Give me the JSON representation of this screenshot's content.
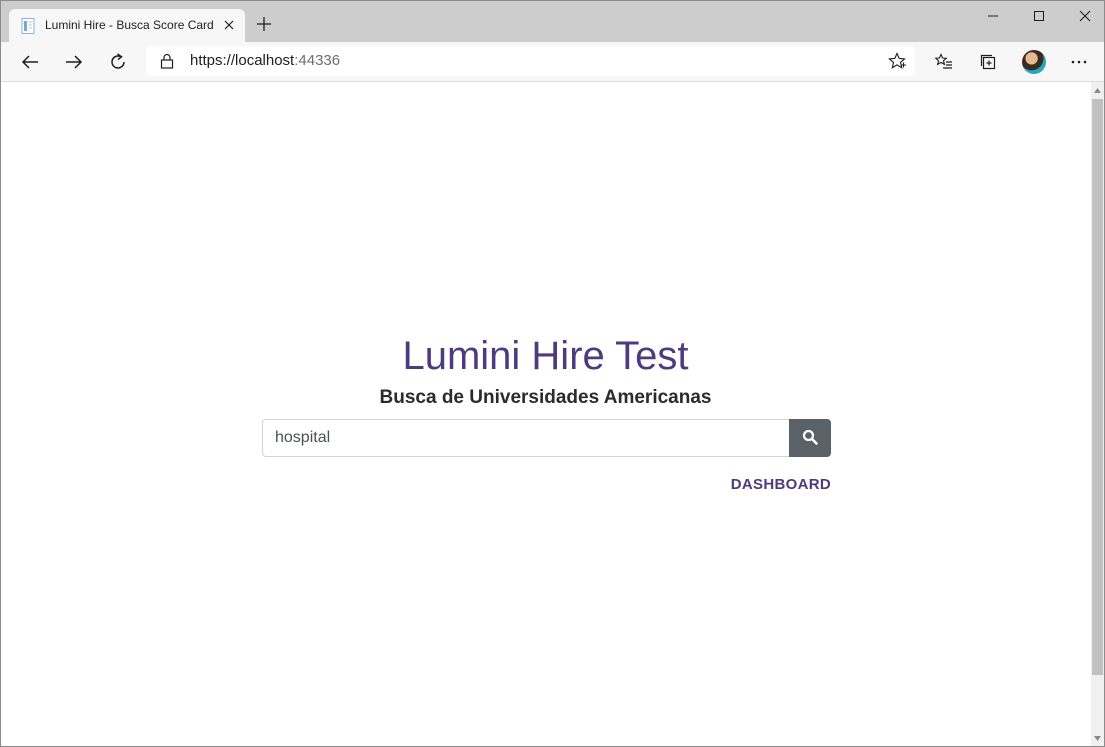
{
  "browser": {
    "tab_title": "Lumini Hire - Busca Score Card",
    "url_main": "https://localhost",
    "url_port": ":44336"
  },
  "page": {
    "title": "Lumini Hire Test",
    "subtitle": "Busca de Universidades Americanas",
    "search": {
      "value": "hospital"
    },
    "dashboard_link": "DASHBOARD"
  },
  "colors": {
    "accent": "#4e3a7e",
    "search_button": "#5a6268"
  },
  "icons": [
    "document-icon",
    "close-icon",
    "plus-icon",
    "minimize-icon",
    "maximize-icon",
    "back-arrow-icon",
    "forward-arrow-icon",
    "refresh-icon",
    "lock-icon",
    "star-icon",
    "favorites-icon",
    "collections-icon",
    "more-icon",
    "search-icon"
  ]
}
